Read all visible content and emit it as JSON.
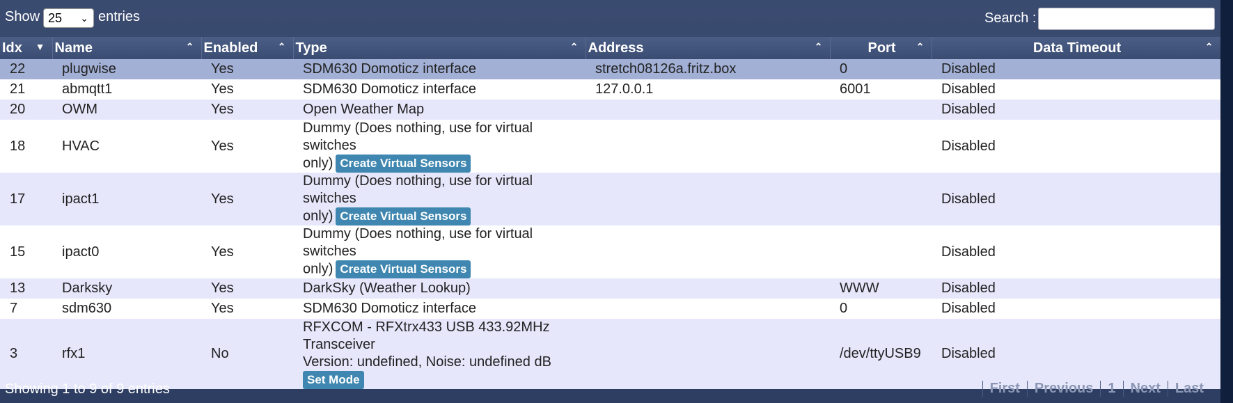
{
  "controls": {
    "show_label": "Show",
    "page_length": "25",
    "entries_label": "entries",
    "search_label": "Search :",
    "search_value": ""
  },
  "columns": [
    "Idx",
    "Name",
    "Enabled",
    "Type",
    "Address",
    "Port",
    "Data Timeout"
  ],
  "rows": [
    {
      "idx": "22",
      "name": "plugwise",
      "enabled": "Yes",
      "type": "SDM630 Domoticz interface",
      "type2": "",
      "type3": "",
      "button": "",
      "address": "stretch08126a.fritz.box",
      "port": "0",
      "timeout": "Disabled"
    },
    {
      "idx": "21",
      "name": "abmqtt1",
      "enabled": "Yes",
      "type": "SDM630 Domoticz interface",
      "type2": "",
      "type3": "",
      "button": "",
      "address": "127.0.0.1",
      "port": "6001",
      "timeout": "Disabled"
    },
    {
      "idx": "20",
      "name": "OWM",
      "enabled": "Yes",
      "type": "Open Weather Map",
      "type2": "",
      "type3": "",
      "button": "",
      "address": "",
      "port": "",
      "timeout": "Disabled"
    },
    {
      "idx": "18",
      "name": "HVAC",
      "enabled": "Yes",
      "type": "Dummy (Does nothing, use for virtual switches",
      "type2": "only)",
      "type3": "",
      "button": "Create Virtual Sensors",
      "address": "",
      "port": "",
      "timeout": "Disabled"
    },
    {
      "idx": "17",
      "name": "ipact1",
      "enabled": "Yes",
      "type": "Dummy (Does nothing, use for virtual switches",
      "type2": "only)",
      "type3": "",
      "button": "Create Virtual Sensors",
      "address": "",
      "port": "",
      "timeout": "Disabled"
    },
    {
      "idx": "15",
      "name": "ipact0",
      "enabled": "Yes",
      "type": "Dummy (Does nothing, use for virtual switches",
      "type2": "only)",
      "type3": "",
      "button": "Create Virtual Sensors",
      "address": "",
      "port": "",
      "timeout": "Disabled"
    },
    {
      "idx": "13",
      "name": "Darksky",
      "enabled": "Yes",
      "type": "DarkSky (Weather Lookup)",
      "type2": "",
      "type3": "",
      "button": "",
      "address": "",
      "port": "WWW",
      "timeout": "Disabled"
    },
    {
      "idx": "7",
      "name": "sdm630",
      "enabled": "Yes",
      "type": "SDM630 Domoticz interface",
      "type2": "",
      "type3": "",
      "button": "",
      "address": "",
      "port": "0",
      "timeout": "Disabled"
    },
    {
      "idx": "3",
      "name": "rfx1",
      "enabled": "No",
      "type": "RFXCOM - RFXtrx433 USB 433.92MHz",
      "type2": "Transceiver",
      "type3": "Version: undefined, Noise: undefined dB",
      "button": "Set Mode",
      "address": "",
      "port": "/dev/ttyUSB9",
      "timeout": "Disabled"
    }
  ],
  "footer": {
    "info": "Showing 1 to 9 of 9 entries",
    "first": "First",
    "previous": "Previous",
    "page": "1",
    "next": "Next",
    "last": "Last"
  }
}
